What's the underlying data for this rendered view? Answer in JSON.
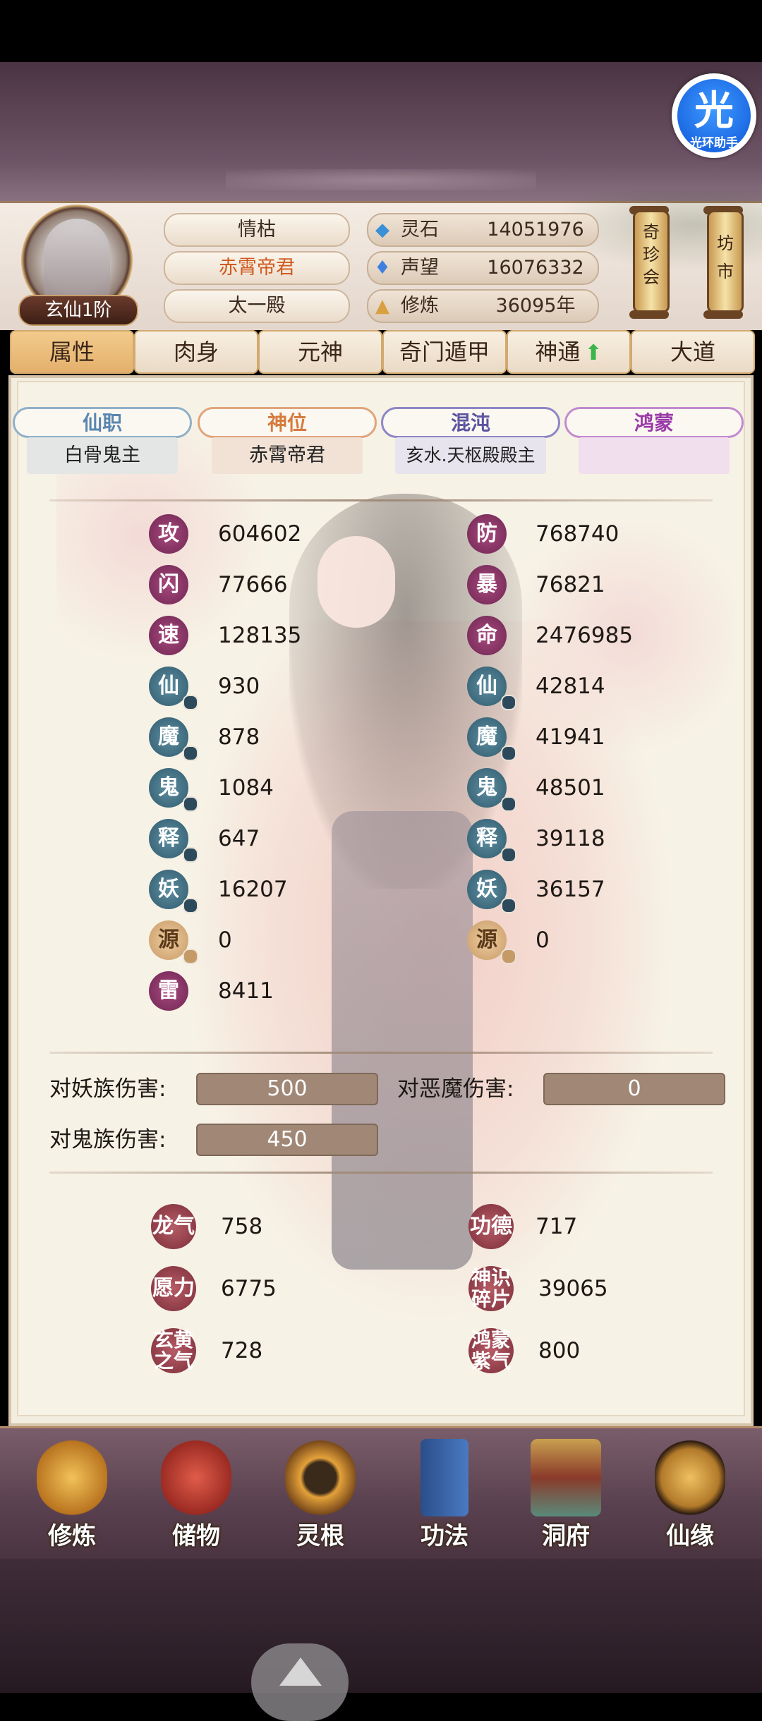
{
  "helper": {
    "icon": "光",
    "label": "光环助手"
  },
  "profile": {
    "realm": "玄仙1阶",
    "title1": "情枯",
    "title2": "赤霄帝君",
    "title3": "太一殿"
  },
  "resources": [
    {
      "icon": "spirit-stone-icon",
      "label": "灵石",
      "value": "14051976"
    },
    {
      "icon": "prestige-icon",
      "label": "声望",
      "value": "16076332"
    },
    {
      "icon": "cultivation-icon",
      "label": "修炼",
      "value": "36095年"
    }
  ],
  "scrolls": [
    "奇珍会",
    "坊市"
  ],
  "tabs": [
    "属性",
    "肉身",
    "元神",
    "奇门遁甲",
    "神通",
    "大道"
  ],
  "ranks": [
    {
      "title": "仙职",
      "value": "白骨鬼主"
    },
    {
      "title": "神位",
      "value": "赤霄帝君"
    },
    {
      "title": "混沌",
      "value": "亥水.天枢殿殿主"
    },
    {
      "title": "鸿蒙",
      "value": ""
    }
  ],
  "stats_left": [
    {
      "icon": "攻",
      "value": "604602"
    },
    {
      "icon": "闪",
      "value": "77666"
    },
    {
      "icon": "速",
      "value": "128135"
    },
    {
      "icon": "仙",
      "value": "930"
    },
    {
      "icon": "魔",
      "value": "878"
    },
    {
      "icon": "鬼",
      "value": "1084"
    },
    {
      "icon": "释",
      "value": "647"
    },
    {
      "icon": "妖",
      "value": "16207"
    },
    {
      "icon": "源",
      "value": "0"
    },
    {
      "icon": "雷",
      "value": "8411"
    }
  ],
  "stats_right": [
    {
      "icon": "防",
      "value": "768740"
    },
    {
      "icon": "暴",
      "value": "76821"
    },
    {
      "icon": "命",
      "value": "2476985"
    },
    {
      "icon": "仙",
      "value": "42814"
    },
    {
      "icon": "魔",
      "value": "41941"
    },
    {
      "icon": "鬼",
      "value": "48501"
    },
    {
      "icon": "释",
      "value": "39118"
    },
    {
      "icon": "妖",
      "value": "36157"
    },
    {
      "icon": "源",
      "value": "0"
    }
  ],
  "damage": [
    {
      "label": "对妖族伤害:",
      "value": "500"
    },
    {
      "label": "对恶魔伤害:",
      "value": "0"
    },
    {
      "label": "对鬼族伤害:",
      "value": "450"
    }
  ],
  "misc": [
    {
      "icon": "龙气",
      "value": "758"
    },
    {
      "icon": "功德",
      "value": "717"
    },
    {
      "icon": "愿力",
      "value": "6775"
    },
    {
      "icon": "神识碎片",
      "value": "39065"
    },
    {
      "icon": "玄黄之气",
      "value": "728"
    },
    {
      "icon": "鸿蒙紫气",
      "value": "800"
    }
  ],
  "nav": [
    "修炼",
    "储物",
    "灵根",
    "功法",
    "洞府",
    "仙缘"
  ]
}
